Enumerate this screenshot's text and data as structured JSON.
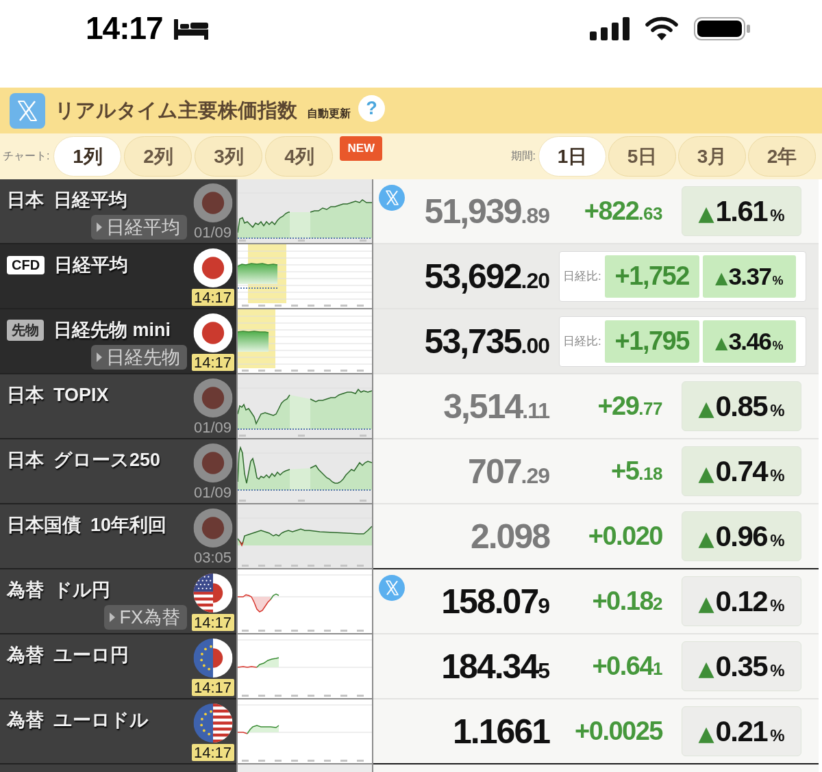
{
  "status_bar": {
    "time": "14:17"
  },
  "header": {
    "title": "リアルタイム主要株価指数",
    "subtitle": "自動更新",
    "help": "?"
  },
  "toolbar": {
    "chart_label": "チャート:",
    "columns": [
      {
        "label": "1列",
        "selected": true
      },
      {
        "label": "2列",
        "selected": false
      },
      {
        "label": "3列",
        "selected": false
      },
      {
        "label": "4列",
        "selected": false
      }
    ],
    "badge": "NEW",
    "period_label": "期間:",
    "periods": [
      {
        "label": "1日",
        "selected": true
      },
      {
        "label": "5日",
        "selected": false
      },
      {
        "label": "3月",
        "selected": false
      },
      {
        "label": "2年",
        "selected": false
      }
    ]
  },
  "sections": [
    {
      "rows": [
        {
          "kind": "plain",
          "region": "日本",
          "name": "日経平均",
          "link": "日経平均",
          "live": false,
          "time": "01/09",
          "x_badge": true,
          "price": {
            "value": "51,939",
            "small": ".89"
          },
          "change": {
            "value": "+822",
            "small": ".63"
          },
          "percent": {
            "arrow": "▲",
            "value": "1.61",
            "unit": "%",
            "color": "#e4eddd"
          }
        },
        {
          "kind": "compare",
          "tag": {
            "kind": "cfd",
            "label": "CFD"
          },
          "name": "日経平均",
          "live": true,
          "time": "14:17",
          "x_badge": false,
          "price": {
            "value": "53,692",
            "small": ".20"
          },
          "compare_label": "日経比:",
          "change": {
            "value": "+1,752",
            "color": "#c8ebbd"
          },
          "percent": {
            "arrow": "▲",
            "value": "3.37",
            "unit": "%",
            "color": "#c8ebbd"
          }
        },
        {
          "kind": "compare",
          "tag": {
            "kind": "futures",
            "label": "先物"
          },
          "name": "日経先物 mini",
          "link": "日経先物",
          "live": true,
          "time": "14:17",
          "x_badge": false,
          "price": {
            "value": "53,735",
            "small": ".00"
          },
          "compare_label": "日経比:",
          "change": {
            "value": "+1,795",
            "color": "#c8ebbd"
          },
          "percent": {
            "arrow": "▲",
            "value": "3.46",
            "unit": "%",
            "color": "#c8ebbd"
          }
        },
        {
          "kind": "plain",
          "region": "日本",
          "name": "TOPIX",
          "live": false,
          "time": "01/09",
          "x_badge": false,
          "price": {
            "value": "3,514",
            "small": ".11"
          },
          "change": {
            "value": "+29",
            "small": ".77"
          },
          "percent": {
            "arrow": "▲",
            "value": "0.85",
            "unit": "%",
            "color": "#e4eddd"
          }
        },
        {
          "kind": "plain",
          "region": "日本",
          "name": "グロース250",
          "live": false,
          "time": "01/09",
          "x_badge": false,
          "price": {
            "value": "707",
            "small": ".29"
          },
          "change": {
            "value": "+5",
            "small": ".18"
          },
          "percent": {
            "arrow": "▲",
            "value": "0.74",
            "unit": "%",
            "color": "#e4eddd"
          }
        },
        {
          "kind": "plain",
          "region": "日本国債",
          "name": "10年利回",
          "live": false,
          "time": "03:05",
          "x_badge": false,
          "price": {
            "value": "2.098"
          },
          "change": {
            "value": "+0.020"
          },
          "percent": {
            "arrow": "▲",
            "value": "0.96",
            "unit": "%",
            "color": "#e4eddd"
          }
        }
      ]
    },
    {
      "rows": [
        {
          "kind": "plain",
          "region": "為替",
          "name": "ドル円",
          "link": "FX為替",
          "live": true,
          "time": "14:17",
          "x_badge": true,
          "price": {
            "value": "158.07",
            "small": "9"
          },
          "change": {
            "value": "+0.18",
            "small": "2"
          },
          "percent": {
            "arrow": "▲",
            "value": "0.12",
            "unit": "%",
            "color": "#ededeb"
          }
        },
        {
          "kind": "plain",
          "region": "為替",
          "name": "ユーロ円",
          "live": true,
          "time": "14:17",
          "x_badge": false,
          "price": {
            "value": "184.34",
            "small": "5"
          },
          "change": {
            "value": "+0.64",
            "small": "1"
          },
          "percent": {
            "arrow": "▲",
            "value": "0.35",
            "unit": "%",
            "color": "#ededeb"
          }
        },
        {
          "kind": "plain",
          "region": "為替",
          "name": "ユーロドル",
          "live": true,
          "time": "14:17",
          "x_badge": false,
          "price": {
            "value": "1.1661"
          },
          "change": {
            "value": "+0.0025"
          },
          "percent": {
            "arrow": "▲",
            "value": "0.21",
            "unit": "%",
            "color": "#ededeb"
          }
        }
      ]
    }
  ]
}
